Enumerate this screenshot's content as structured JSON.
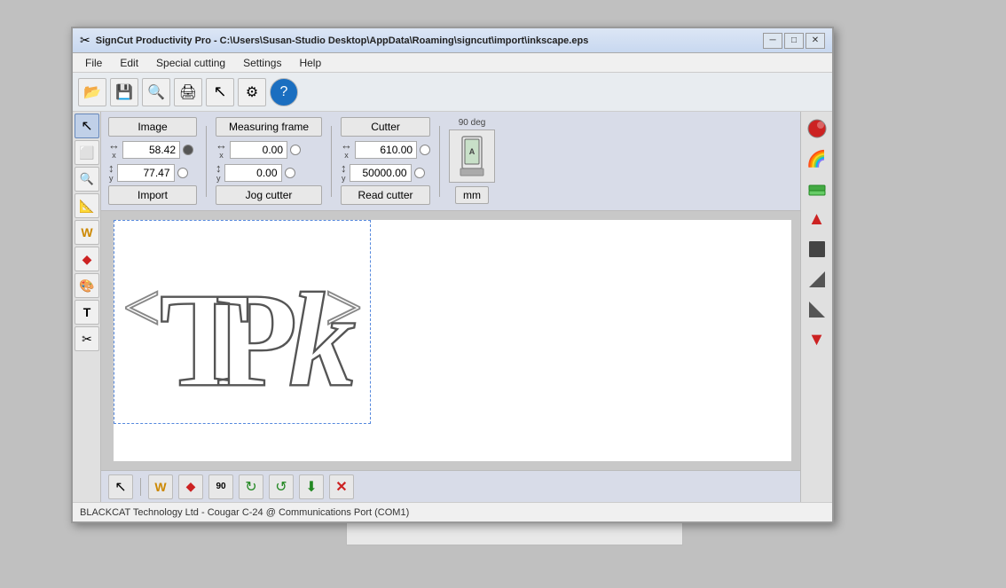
{
  "window": {
    "title": "SignCut Productivity Pro - C:\\Users\\Susan-Studio Desktop\\AppData\\Roaming\\signcut\\import\\inkscape.eps",
    "icon": "✂"
  },
  "titlebar": {
    "minimize": "─",
    "maximize": "□",
    "close": "✕"
  },
  "menu": {
    "items": [
      "File",
      "Edit",
      "Special cutting",
      "Settings",
      "Help"
    ]
  },
  "toolbar": {
    "buttons": [
      {
        "name": "open",
        "icon": "📂"
      },
      {
        "name": "save",
        "icon": "💾"
      },
      {
        "name": "search",
        "icon": "🔍"
      },
      {
        "name": "print",
        "icon": "🖨"
      },
      {
        "name": "pointer",
        "icon": "↖"
      },
      {
        "name": "settings",
        "icon": "⚙"
      },
      {
        "name": "help",
        "icon": "❓"
      }
    ]
  },
  "control_panel": {
    "image_section": {
      "label": "Image",
      "x_value": "58.42",
      "y_value": "77.47",
      "button": "Import"
    },
    "measuring_section": {
      "label": "Measuring frame",
      "x_value": "0.00",
      "y_value": "0.00",
      "button": "Jog cutter"
    },
    "cutter_section": {
      "label": "Cutter",
      "x_value": "610.00",
      "y_value": "50000.00",
      "button": "Read cutter",
      "deg_label": "90 deg"
    },
    "mm_button": "mm"
  },
  "left_tools": [
    {
      "name": "select",
      "icon": "↖",
      "active": true
    },
    {
      "name": "select-box",
      "icon": "⬜"
    },
    {
      "name": "zoom",
      "icon": "🔍"
    },
    {
      "name": "measure",
      "icon": "📐"
    },
    {
      "name": "weld",
      "icon": "W"
    },
    {
      "name": "diamond",
      "icon": "◆"
    },
    {
      "name": "paint",
      "icon": "🎨"
    },
    {
      "name": "text",
      "icon": "T"
    },
    {
      "name": "scissors",
      "icon": "✂"
    }
  ],
  "right_panel": [
    {
      "name": "color-red",
      "color": "#cc2222"
    },
    {
      "name": "rainbow",
      "icon": "🌈"
    },
    {
      "name": "layers",
      "icon": "🟩"
    },
    {
      "name": "arrow-up",
      "icon": "▲"
    },
    {
      "name": "box-dark",
      "icon": "■"
    },
    {
      "name": "arrow-diag-1",
      "icon": "↗"
    },
    {
      "name": "arrow-diag-2",
      "icon": "↙"
    },
    {
      "name": "arrow-down",
      "icon": "▼"
    }
  ],
  "bottom_toolbar": {
    "buttons": [
      {
        "name": "select-tool",
        "icon": "↖"
      },
      {
        "name": "weld-tool",
        "icon": "W"
      },
      {
        "name": "diamond-tool",
        "icon": "◆"
      },
      {
        "name": "rotate-90",
        "icon": "90"
      },
      {
        "name": "rotate-cw",
        "icon": "↻"
      },
      {
        "name": "rotate-ccw",
        "icon": "↺"
      },
      {
        "name": "down-arrow",
        "icon": "⬇"
      },
      {
        "name": "close-x",
        "icon": "✕",
        "color": "#cc2222"
      }
    ]
  },
  "status_bar": {
    "text": "BLACKCAT Technology Ltd - Cougar C-24 @ Communications Port (COM1)"
  },
  "canvas": {
    "design_text": "TPk"
  }
}
